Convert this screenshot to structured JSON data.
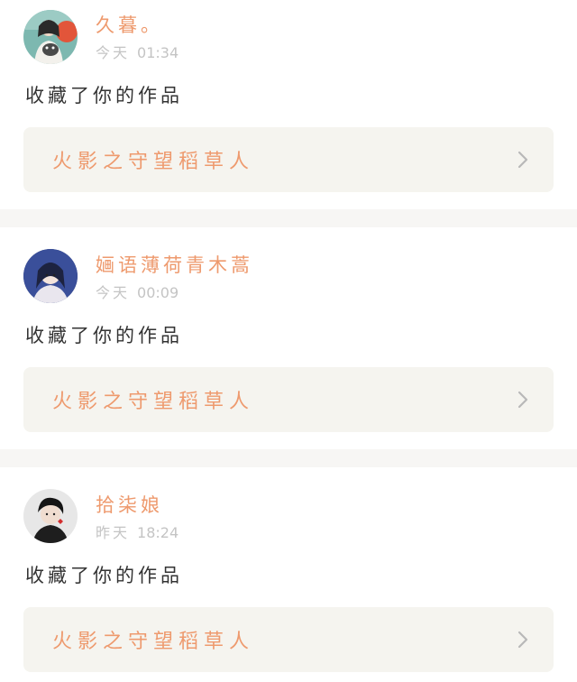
{
  "notifications": [
    {
      "username": "久暮。",
      "day": "今天",
      "time": "01:34",
      "action": "收藏了你的作品",
      "work_title": "火影之守望稻草人",
      "avatar": "avatar-girl-with-cat"
    },
    {
      "username": "婳语薄荷青木蒿",
      "day": "今天",
      "time": "00:09",
      "action": "收藏了你的作品",
      "work_title": "火影之守望稻草人",
      "avatar": "avatar-girl-blue"
    },
    {
      "username": "拾柒娘",
      "day": "昨天",
      "time": "18:24",
      "action": "收藏了你的作品",
      "work_title": "火影之守望稻草人",
      "avatar": "avatar-boy-dark"
    }
  ],
  "colors": {
    "accent": "#ee9a6e",
    "timestamp": "#c4c4c4",
    "card_link_bg": "#f5f4ef",
    "separator": "#f7f6f4"
  }
}
